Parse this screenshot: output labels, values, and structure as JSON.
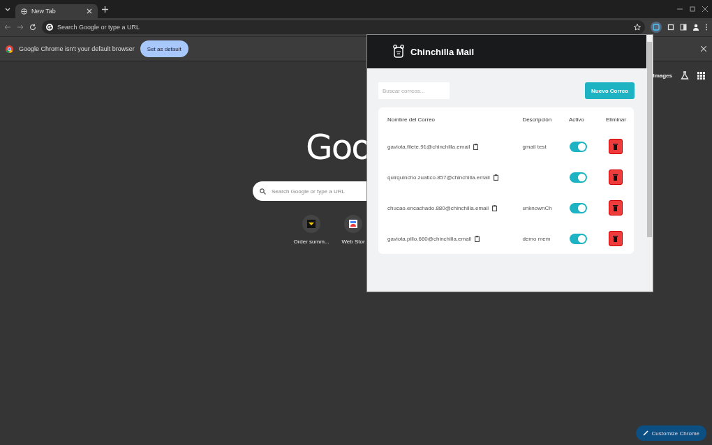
{
  "browser": {
    "tab": {
      "title": "New Tab",
      "selected": true
    },
    "address_placeholder": "Search Google or type a URL",
    "infobar": {
      "message": "Google Chrome isn't your default browser",
      "button": "Set as default"
    }
  },
  "new_tab": {
    "logo": "Goo",
    "search_placeholder": "Search Google or type a URL",
    "header_links": [
      "Images"
    ],
    "shortcuts": [
      {
        "label": "Order summ..."
      },
      {
        "label": "Web Stor"
      }
    ],
    "customize_button": "Customize Chrome"
  },
  "popup": {
    "title": "Chinchilla Mail",
    "search_placeholder": "Buscar correos...",
    "new_button": "Nuevo Correo",
    "columns": [
      "Nombre del Correo",
      "Descripción",
      "Activo",
      "Eliminar"
    ],
    "rows": [
      {
        "email": "gaviota.filete.91@chinchilla.email",
        "description": "gmail test",
        "active": true
      },
      {
        "email": "quirquincho.zuatico.857@chinchilla.email",
        "description": "",
        "active": true
      },
      {
        "email": "chucao.encachado.880@chinchilla.email",
        "description": "unknownCh",
        "active": true
      },
      {
        "email": "gaviota.pillo.660@chinchilla.email",
        "description": "demo mem",
        "active": true
      }
    ]
  }
}
